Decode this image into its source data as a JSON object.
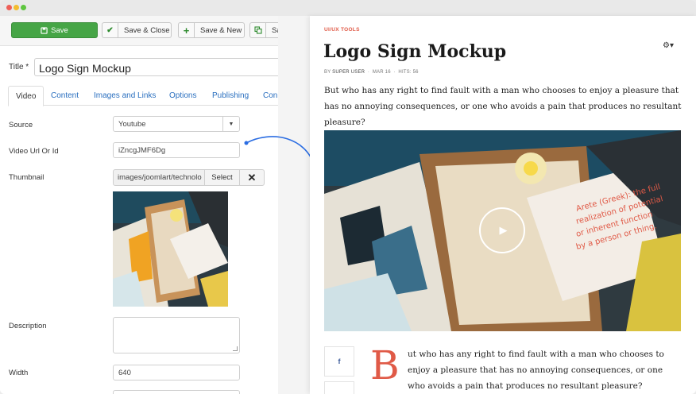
{
  "toolbar": {
    "save_label": "Save",
    "save_close_label": "Save & Close",
    "save_new_label": "Save & New",
    "save_copy_label": "Sa"
  },
  "form": {
    "title_label": "Title *",
    "title_value": "Logo Sign Mockup",
    "tabs": [
      "Video",
      "Content",
      "Images and Links",
      "Options",
      "Publishing",
      "Con"
    ],
    "source_label": "Source",
    "source_value": "Youtube",
    "video_url_label": "Video Url Or Id",
    "video_url_value": "iZncgJMF6Dg",
    "thumbnail_label": "Thumbnail",
    "thumbnail_value": "images/joomlart/technolo",
    "select_label": "Select",
    "clear_label": "✕",
    "description_label": "Description",
    "width_label": "Width",
    "width_value": "640"
  },
  "preview": {
    "category": "UI/UX TOOLS",
    "title": "Logo Sign Mockup",
    "meta_by": "BY",
    "meta_author": "SUPER USER",
    "meta_date": "MAR 16",
    "meta_hits": "HITS: 56",
    "intro": "But who has any right to find fault with a man who chooses to enjoy a pleasure that has no annoying consequences, or one who avoids a pain that produces no resultant pleasure?",
    "dropcap": "B",
    "body": "ut who has any right to find fault with a man who chooses to enjoy a pleasure that has no annoying consequences, or one who avoids a pain that produces no resultant pleasure?",
    "video_caption": "Arete (Greek): the full realization of potential or inherent function by a person or thing.",
    "share_label": "f"
  },
  "colors": {
    "save_green": "#46a546",
    "accent_red": "#e05a47",
    "link_blue": "#2a6fbf",
    "arrow_blue": "#2b6de2"
  }
}
